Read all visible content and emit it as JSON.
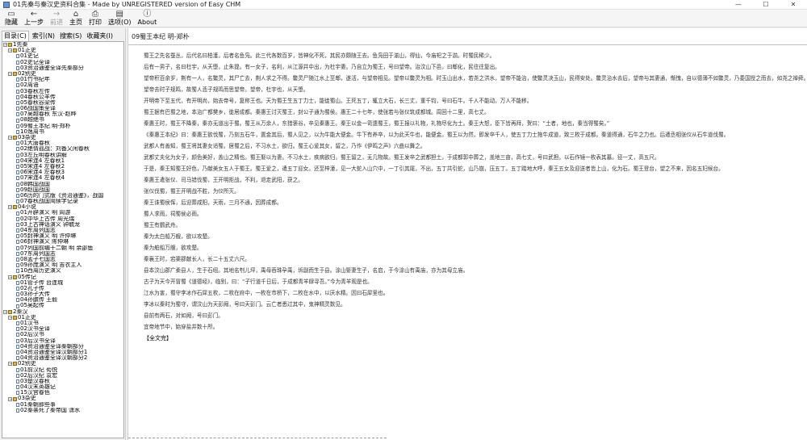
{
  "window": {
    "title": "01先秦与秦汉史资料合集 - Made by UNREGISTERED version of Easy CHM",
    "buttons": {
      "minimize": "—",
      "maximize": "☐",
      "close": "✕"
    }
  },
  "toolbar": {
    "items": [
      {
        "icon": "▭",
        "label": "隐藏",
        "disabled": false
      },
      {
        "icon": "←",
        "label": "上一步",
        "disabled": false
      },
      {
        "icon": "→",
        "label": "前进",
        "disabled": true
      },
      {
        "icon": "⌂",
        "label": "主页",
        "disabled": false
      },
      {
        "icon": "⎙",
        "label": "打印",
        "disabled": false
      },
      {
        "icon": "▤",
        "label": "选项(O)",
        "disabled": false
      },
      {
        "icon": "ⓘ",
        "label": "About",
        "disabled": false
      }
    ]
  },
  "tabs": [
    {
      "label": "目录(C)",
      "active": true
    },
    {
      "label": "索引(N)",
      "active": false
    },
    {
      "label": "搜索(S)",
      "active": false
    },
    {
      "label": "收藏夹(I)",
      "active": false
    }
  ],
  "tree": [
    {
      "level": 0,
      "type": "book",
      "label": "1先秦"
    },
    {
      "level": 1,
      "type": "book",
      "label": "01正史"
    },
    {
      "level": 2,
      "type": "page",
      "label": "01史记"
    },
    {
      "level": 2,
      "type": "page",
      "label": "02史记全译"
    },
    {
      "level": 2,
      "type": "page",
      "label": "03资治通鉴全译先秦部分"
    },
    {
      "level": 1,
      "type": "book",
      "label": "02别史"
    },
    {
      "level": 2,
      "type": "page",
      "label": "01竹书纪年"
    },
    {
      "level": 2,
      "type": "page",
      "label": "02周语"
    },
    {
      "level": 2,
      "type": "page",
      "label": "03春秋左传"
    },
    {
      "level": 2,
      "type": "page",
      "label": "04春秋公羊传"
    },
    {
      "level": 2,
      "type": "page",
      "label": "05春秋谷梁传"
    },
    {
      "level": 2,
      "type": "page",
      "label": "06战国策全译"
    },
    {
      "level": 2,
      "type": "page",
      "label": "07吴越春秋 东汉-赵晔"
    },
    {
      "level": 2,
      "type": "page",
      "label": "08越绝书"
    },
    {
      "level": 2,
      "type": "page",
      "label": "09蜀王本纪 明-郑朴"
    },
    {
      "level": 2,
      "type": "page",
      "label": "10逸周书"
    },
    {
      "level": 1,
      "type": "book",
      "label": "03杂史"
    },
    {
      "level": 2,
      "type": "page",
      "label": "01大唐春秋"
    },
    {
      "level": 2,
      "type": "page",
      "label": "02绝情孤战：刘备又闲春秋"
    },
    {
      "level": 2,
      "type": "page",
      "label": "03左丘明春秋讲解"
    },
    {
      "level": 2,
      "type": "page",
      "label": "04宋连4 左春秋1"
    },
    {
      "level": 2,
      "type": "page",
      "label": "05宋连4 左春秋2"
    },
    {
      "level": 2,
      "type": "page",
      "label": "06宋连4 左春秋3"
    },
    {
      "level": 2,
      "type": "page",
      "label": "07宋连4 左春秋4"
    },
    {
      "level": 2,
      "type": "page",
      "label": "08韩国战国"
    },
    {
      "level": 2,
      "type": "page",
      "label": "09赵国战国"
    },
    {
      "level": 2,
      "type": "page",
      "label": "06历的门式版《资治通鉴》，战国"
    },
    {
      "level": 2,
      "type": "page",
      "label": "07春秋战国简牍字记录"
    },
    {
      "level": 1,
      "type": "book",
      "label": "04小说"
    },
    {
      "level": 2,
      "type": "page",
      "label": "01开辟演义 明 周游"
    },
    {
      "level": 2,
      "type": "page",
      "label": "02中华上古传 周光瑞"
    },
    {
      "level": 2,
      "type": "page",
      "label": "03上古神话演义 钟毓龙"
    },
    {
      "level": 2,
      "type": "page",
      "label": "04东周列国志"
    },
    {
      "level": 2,
      "type": "page",
      "label": "05封神演义 明 许仲琳"
    },
    {
      "level": 2,
      "type": "page",
      "label": "06封神演义 陈仲琳"
    },
    {
      "level": 2,
      "type": "page",
      "label": "07列国前编十二朝 明 余邵鱼"
    },
    {
      "level": 2,
      "type": "page",
      "label": "07东周列国志"
    },
    {
      "level": 2,
      "type": "page",
      "label": "08孟子七国志"
    },
    {
      "level": 2,
      "type": "page",
      "label": "09孙庞演义 明 吉衣主人"
    },
    {
      "level": 2,
      "type": "page",
      "label": "10西周历史演义"
    },
    {
      "level": 1,
      "type": "book",
      "label": "05传记"
    },
    {
      "level": 2,
      "type": "page",
      "label": "01管子传 台连城"
    },
    {
      "level": 2,
      "type": "page",
      "label": "02孔子传"
    },
    {
      "level": 2,
      "type": "page",
      "label": "03孙子大传"
    },
    {
      "level": 2,
      "type": "page",
      "label": "04孙膑传 王毅"
    },
    {
      "level": 2,
      "type": "page",
      "label": "05吴起传"
    },
    {
      "level": 0,
      "type": "book",
      "label": "2秦汉"
    },
    {
      "level": 1,
      "type": "book",
      "label": "01正史"
    },
    {
      "level": 2,
      "type": "page",
      "label": "01汉书"
    },
    {
      "level": 2,
      "type": "page",
      "label": "02汉书全译"
    },
    {
      "level": 2,
      "type": "page",
      "label": "02后汉书"
    },
    {
      "level": 2,
      "type": "page",
      "label": "03后汉书全译"
    },
    {
      "level": 2,
      "type": "page",
      "label": "04资治通鉴全译秦朝部分"
    },
    {
      "level": 2,
      "type": "page",
      "label": "04资治通鉴全译汉朝部分1"
    },
    {
      "level": 2,
      "type": "page",
      "label": "04资治通鉴全译汉朝部分2"
    },
    {
      "level": 1,
      "type": "book",
      "label": "02别史"
    },
    {
      "level": 2,
      "type": "page",
      "label": "01前汉纪 荀悦"
    },
    {
      "level": 2,
      "type": "page",
      "label": "02后汉纪 袁宏"
    },
    {
      "level": 2,
      "type": "page",
      "label": "03楚汉春秋"
    },
    {
      "level": 2,
      "type": "page",
      "label": "04汉末英雄记"
    },
    {
      "level": 2,
      "type": "page",
      "label": "15汉宫春色"
    },
    {
      "level": 1,
      "type": "book",
      "label": "03杂史"
    },
    {
      "level": 2,
      "type": "page",
      "label": "01秦朝那些事"
    },
    {
      "level": 2,
      "type": "page",
      "label": "02秦亲死了秦帝国 潇水"
    }
  ],
  "document": {
    "heading": "09蜀王本纪 明-郑朴",
    "paragraphs": [
      "蜀王之先名蚕丛，后代名曰柏濩，后者名鱼凫。此三代各数百岁，皆神化不死，其民亦颇随王去。鱼凫田于湔山，得仙，今庙祀之于湔。时蜀民稀少。",
      "后有一男子，名曰杜宇，从天堕，止朱提。有一女子，名利，从江源井中出，为杜宇妻。乃自立为蜀王，号曰望帝。治汶山下邑，曰郫化，民往往复出。",
      "望帝积百余岁，荆有一人，名鳖灵，其尸亡去，荆人求之不得。鳖灵尸随江水上至郫，遂活，与望帝相见。望帝以鳖灵为相。时玉山出水，若尧之洪水，望帝不能治，使鳖灵决玉山，民得安处。鳖灵治水去后，望帝与其妻通，惭愧，自以德薄不如鳖灵，乃委国授之而去，如尧之禅舜。",
      "望帝去时子规鸣，故蜀人悲子规鸣而思望帝。望帝，杜宇也，从天堕。",
      "开明帝下至五代，有开明尚，始去帝号，复称王也。天为蜀王生五丁力士，能徙蜀山。王死五丁，辄立大石，长三丈，重千钧，号曰石牛。千人不能动，万人不能移。",
      "蜀王据有巴蜀之地，本治广都樊乡，徙居成都。秦惠王讨灭蜀王，封公子通为蜀侯。惠王二十七年，使张若与张仪筑成都城。周回十二里，高七丈。",
      "秦惠王时，蜀王不降秦，秦亦无道出于蜀。蜀王从万余人，东猎褒谷，卒见秦惠王。秦王以金一笥遗蜀王，蜀王报以礼物，礼物尽化为土。秦王大怒，臣下皆再拜，贺曰：“土者，地也，秦当得蜀矣。”",
      "《秦惠王本纪》曰：秦惠王欲伐蜀，乃刻五石牛，置金其后，蜀人见之，以为牛能大便金。牛下有养卒，以为此天牛也，能便金。蜀王以为然，即发卒千人，使五丁力士拖牛成道，致三枚于成都。秦道得通，石牛之力也。后遣丞相张仪从石牛道伐蜀。",
      "武都人有善知，蜀王将其妻女适蜀。居蜀之后，不习水土，欲归。蜀王心爱其女，留之，乃作《伊鸣之声》六曲以舞之。",
      "武都丈夫化为女子，颜色美好，盖山之精也。蜀王娶以为妻。不习水土，疾病欲归，蜀王留之，无几物故。蜀王发卒之武都担土，于成都郭中葬之，盖地三亩，高七丈，号曰武担。以石作镜一枚表其墓。径一丈，高五尺。",
      "于是，秦王知蜀王好色，乃献美女五人于蜀王。蜀王爱之，遣五丁迎女。还至梓潼，见一大蛇入山穴中，一丁引其尾，不出，五丁共引蛇，山乃崩，压五丁。五丁踏地大呼，秦王五女及迎送者皆上山，化为石。蜀王登台，望之不来，因名五妇候台。",
      "秦惠王遣张仪、司马错伐蜀，王开明拒战，不利，退走武阳，获之。",
      "张仪伐蜀，蜀王开明战不胜，为仪所灭。",
      "秦王诛蜀侯恽，后迎葬咸阳，天雨，三月不通，因葬成都。",
      "蜀人求雨，祠蜀侯必雨。",
      "蜀王有鹦武舟。",
      "秦为太白船万艘，欲以攻楚。",
      "秦为舶船万艘，欲攻楚。",
      "秦襄王时，宕渠郡献长人，长二十五丈六尺。",
      "县本汶山郡广柔县人，生于石纽。其地名刳儿坪，禹母吞珠孕禹，坼副而生于县。涂山娶妻生子，名启，于今涂山有禹庙，亦为其母立庙。",
      "古子为天今开冒蜀《道德经》，临别，曰：“子行道千日后，于成都青羊肆寻吾。”今为青羊观是也。",
      "江水为害，蜀守李冰作石犀五枚，二枚在府中，一枚在市桥下，二枚在水中，以厌水精。因曰石犀里也。",
      "李冰以秦时为蜀守，谓汶山为天彭阙，号曰天彭门。云亡者悉过其中，鬼神精灵数见。",
      "县前有两石，对如阙，号曰彭门。",
      "宜帝地节中，始穿盐井数十所。"
    ],
    "link": "【全文完】"
  }
}
